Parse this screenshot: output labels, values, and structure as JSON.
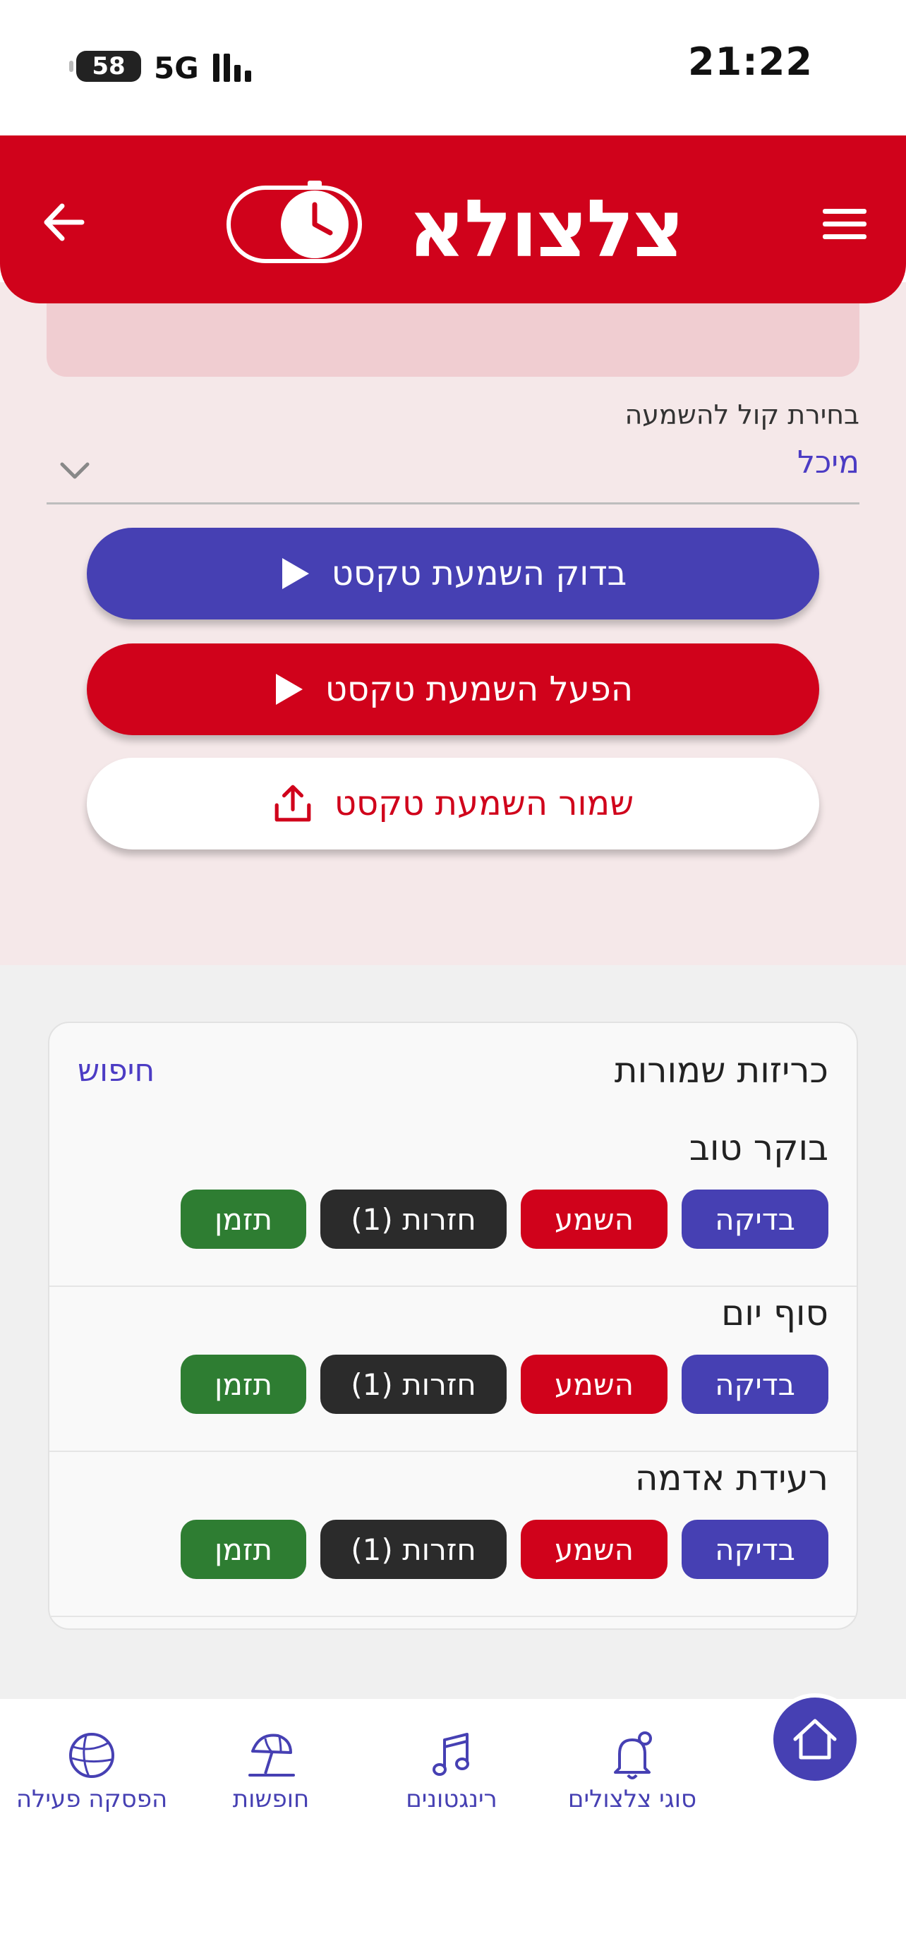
{
  "status_bar": {
    "time": "21:22",
    "battery": "58",
    "network": "5G"
  },
  "header": {
    "logo_text": "צלצולא"
  },
  "voice": {
    "label": "בחירת קול להשמעה",
    "value": "מיכל"
  },
  "buttons": {
    "test": "בדוק השמעת טקסט",
    "play": "הפעל השמעת טקסט",
    "save": "שמור השמעת טקסט"
  },
  "saved": {
    "title": "כריזות שמורות",
    "search": "חיפוש",
    "items": [
      {
        "name": "בוקר טוב",
        "check": "בדיקה",
        "listen": "השמע",
        "repeat": "חזרות (1)",
        "schedule": "תזמן"
      },
      {
        "name": "סוף יום",
        "check": "בדיקה",
        "listen": "השמע",
        "repeat": "חזרות (1)",
        "schedule": "תזמן"
      },
      {
        "name": "רעידת אדמה",
        "check": "בדיקה",
        "listen": "השמע",
        "repeat": "חזרות (1)",
        "schedule": "תזמן"
      }
    ]
  },
  "nav": {
    "items": [
      {
        "label": "סוגי צלצולים",
        "icon": "bell-icon"
      },
      {
        "label": "רינגטונים",
        "icon": "music-note-icon"
      },
      {
        "label": "חופשות",
        "icon": "beach-umbrella-icon"
      },
      {
        "label": "הפסקה פעילה",
        "icon": "ball-icon"
      }
    ],
    "home_icon": "home-icon"
  },
  "colors": {
    "brand_red": "#d0021b",
    "brand_blue": "#4640b3",
    "schedule_green": "#2e7d32",
    "repeat_dark": "#2b2b2b"
  }
}
